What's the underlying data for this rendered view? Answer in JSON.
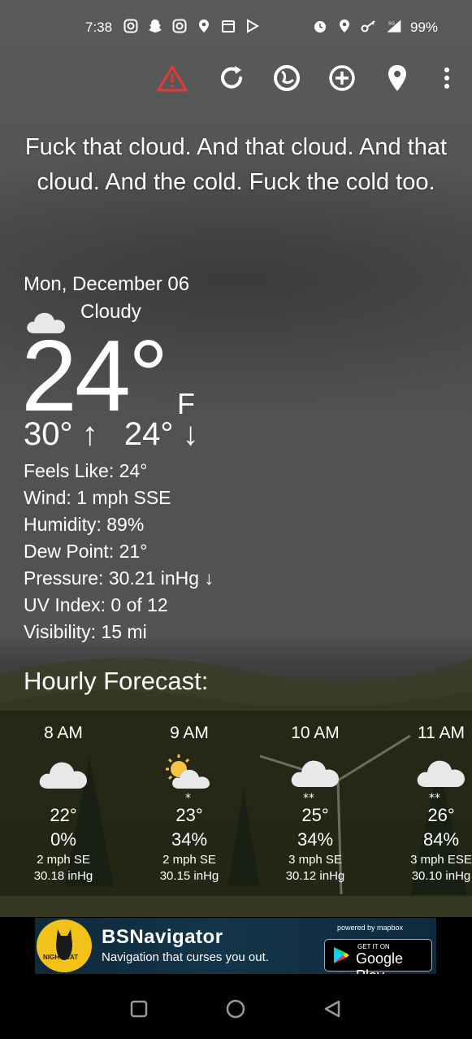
{
  "status_bar": {
    "time": "7:38",
    "left_icons": [
      "instagram-icon",
      "snapchat-icon",
      "instagram-icon",
      "location-pin-icon",
      "calendar-icon",
      "play-store-icon"
    ],
    "right_icons": [
      "alarm-icon",
      "location-pin-icon",
      "key-icon",
      "signal-5g-icon"
    ],
    "network": "5G",
    "battery": "99%"
  },
  "toolbar": {
    "buttons": [
      "alert-triangle-icon",
      "refresh-icon",
      "theme-icon",
      "add-location-icon",
      "location-pin-icon",
      "more-vert-icon"
    ],
    "alert_color": "#e53935"
  },
  "quote": "Fuck that cloud. And that cloud. And that cloud. And the cold. Fuck the cold too.",
  "current": {
    "date": "Mon, December 06",
    "condition": "Cloudy",
    "condition_icon": "cloud-icon",
    "temperature": "24°",
    "unit": "F",
    "high": "30°",
    "high_arrow": "↑",
    "low": "24°",
    "low_arrow": "↓",
    "details": [
      {
        "label": "Feels Like:",
        "value": "24°"
      },
      {
        "label": "Wind:",
        "value": "1 mph SSE"
      },
      {
        "label": "Humidity:",
        "value": "89%"
      },
      {
        "label": "Dew Point:",
        "value": "21°"
      },
      {
        "label": "Pressure:",
        "value": "30.21 inHg ↓"
      },
      {
        "label": "UV Index:",
        "value": "0 of 12"
      },
      {
        "label": "Visibility:",
        "value": "15 mi"
      }
    ]
  },
  "hourly": {
    "title": "Hourly Forecast:",
    "items": [
      {
        "time": "8 AM",
        "icon": "cloud-icon",
        "temp": "22°",
        "pop": "0%",
        "wind": "2 mph SE",
        "pressure": "30.18 inHg"
      },
      {
        "time": "9 AM",
        "icon": "partly-sunny-snow-icon",
        "temp": "23°",
        "pop": "34%",
        "wind": "2 mph SE",
        "pressure": "30.15 inHg"
      },
      {
        "time": "10 AM",
        "icon": "snow-cloud-icon",
        "temp": "25°",
        "pop": "34%",
        "wind": "3 mph SE",
        "pressure": "30.12 inHg"
      },
      {
        "time": "11 AM",
        "icon": "snow-cloud-icon",
        "temp": "26°",
        "pop": "84%",
        "wind": "3 mph ESE",
        "pressure": "30.10 inHg"
      }
    ]
  },
  "ad": {
    "logo_text": "NIGHT CAT",
    "title": "BSNavigator",
    "subtitle": "Navigation that curses you out.",
    "powered_by": "powered by mapbox",
    "store_small": "GET IT ON",
    "store_big": "Google Play"
  },
  "nav_bar": {
    "buttons": [
      "recents-square-icon",
      "home-circle-icon",
      "back-triangle-icon"
    ]
  }
}
